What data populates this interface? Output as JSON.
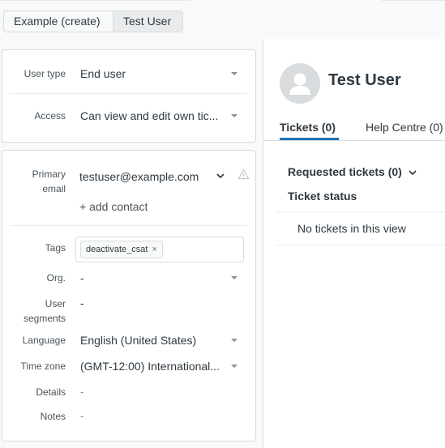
{
  "breadcrumb": {
    "items": [
      "Example (create)",
      "Test User"
    ]
  },
  "user_card": {
    "user_type_label": "User type",
    "user_type_value": "End user",
    "access_label": "Access",
    "access_value": "Can view and edit own tic..."
  },
  "details_card": {
    "primary_email_label_line1": "Primary",
    "primary_email_label_line2": "email",
    "primary_email_value": "testuser@example.com",
    "add_contact": "+ add contact",
    "tags_label": "Tags",
    "tags": [
      "deactivate_csat"
    ],
    "tag_remove_glyph": "×",
    "org_label": "Org.",
    "org_value": "-",
    "user_segments_label_line1": "User",
    "user_segments_label_line2": "segments",
    "user_segments_value": "-",
    "language_label": "Language",
    "language_value": "English (United States)",
    "timezone_label": "Time zone",
    "timezone_value": "(GMT-12:00) International...",
    "details_label": "Details",
    "details_value": "-",
    "notes_label": "Notes",
    "notes_value": "-"
  },
  "profile": {
    "name": "Test User",
    "tabs": [
      {
        "label": "Tickets (0)",
        "active": true
      },
      {
        "label": "Help Centre (0)",
        "active": false
      }
    ],
    "requested_tickets": "Requested tickets (0)",
    "ticket_status_header": "Ticket status",
    "empty_message": "No tickets in this view"
  },
  "colors": {
    "accent": "#1f73b7",
    "border": "#d8dcde",
    "text": "#2f3941"
  },
  "icons": [
    "caret-down-icon",
    "chevron-down-icon",
    "warning-icon",
    "user-avatar-icon",
    "tag-remove-icon"
  ]
}
